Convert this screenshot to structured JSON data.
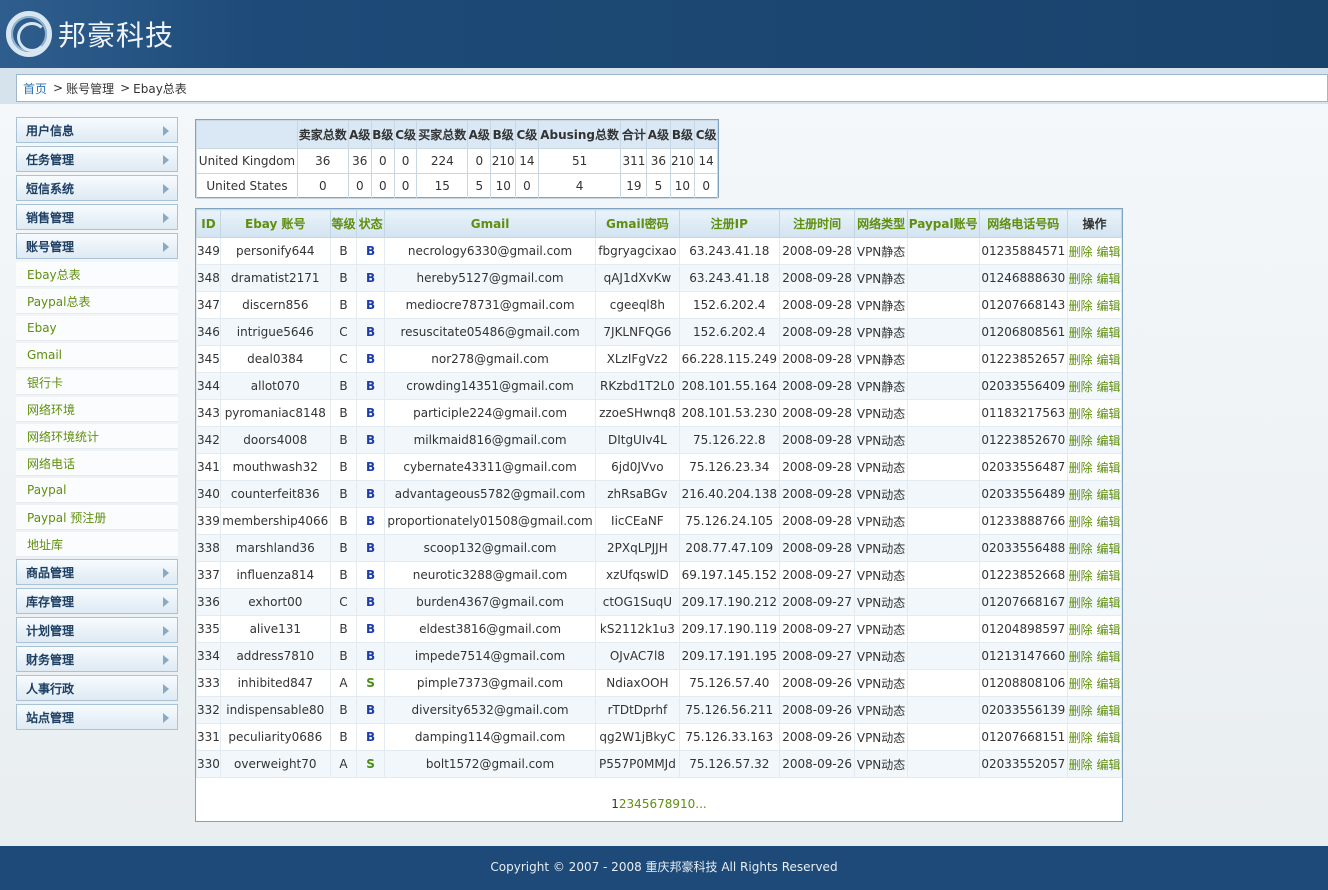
{
  "logo": {
    "text": "邦豪科技"
  },
  "breadcrumb": {
    "home": "首页",
    "level1": "账号管理",
    "level2": "Ebay总表"
  },
  "sidebar": {
    "top": [
      {
        "label": "用户信息"
      },
      {
        "label": "任务管理"
      },
      {
        "label": "短信系统"
      },
      {
        "label": "销售管理"
      },
      {
        "label": "账号管理"
      }
    ],
    "sub": [
      {
        "label": "Ebay总表"
      },
      {
        "label": "Paypal总表"
      },
      {
        "label": "Ebay"
      },
      {
        "label": "Gmail"
      },
      {
        "label": "银行卡"
      },
      {
        "label": "网络环境"
      },
      {
        "label": "网络环境统计"
      },
      {
        "label": "网络电话"
      },
      {
        "label": "Paypal"
      },
      {
        "label": "Paypal 预注册"
      },
      {
        "label": "地址库"
      }
    ],
    "bottom": [
      {
        "label": "商品管理"
      },
      {
        "label": "库存管理"
      },
      {
        "label": "计划管理"
      },
      {
        "label": "财务管理"
      },
      {
        "label": "人事行政"
      },
      {
        "label": "站点管理"
      }
    ]
  },
  "summary": {
    "headers": [
      "",
      "卖家总数",
      "A级",
      "B级",
      "C级",
      "买家总数",
      "A级",
      "B级",
      "C级",
      "Abusing总数",
      "合计",
      "A级",
      "B级",
      "C级"
    ],
    "rows": [
      [
        "United Kingdom",
        "36",
        "36",
        "0",
        "0",
        "224",
        "0",
        "210",
        "14",
        "51",
        "311",
        "36",
        "210",
        "14"
      ],
      [
        "United States",
        "0",
        "0",
        "0",
        "0",
        "15",
        "5",
        "10",
        "0",
        "4",
        "19",
        "5",
        "10",
        "0"
      ]
    ]
  },
  "grid": {
    "headers": [
      "ID",
      "Ebay 账号",
      "等级",
      "状态",
      "Gmail",
      "Gmail密码",
      "注册IP",
      "注册时间",
      "网络类型",
      "Paypal账号",
      "网络电话号码",
      "操作"
    ],
    "delete_label": "删除",
    "edit_label": "编辑",
    "rows": [
      [
        "349",
        "personify644",
        "B",
        "B",
        "necrology6330@gmail.com",
        "fbgryagcixao",
        "63.243.41.18",
        "2008-09-28",
        "VPN静态",
        "",
        "01235884571"
      ],
      [
        "348",
        "dramatist2171",
        "B",
        "B",
        "hereby5127@gmail.com",
        "qAJ1dXvKw",
        "63.243.41.18",
        "2008-09-28",
        "VPN静态",
        "",
        "01246888630"
      ],
      [
        "347",
        "discern856",
        "B",
        "B",
        "mediocre78731@gmail.com",
        "cgeeql8h",
        "152.6.202.4",
        "2008-09-28",
        "VPN静态",
        "",
        "01207668143"
      ],
      [
        "346",
        "intrigue5646",
        "C",
        "B",
        "resuscitate05486@gmail.com",
        "7JKLNFQG6",
        "152.6.202.4",
        "2008-09-28",
        "VPN静态",
        "",
        "01206808561"
      ],
      [
        "345",
        "deal0384",
        "C",
        "B",
        "nor278@gmail.com",
        "XLzIFgVz2",
        "66.228.115.249",
        "2008-09-28",
        "VPN静态",
        "",
        "01223852657"
      ],
      [
        "344",
        "allot070",
        "B",
        "B",
        "crowding14351@gmail.com",
        "RKzbd1T2L0",
        "208.101.55.164",
        "2008-09-28",
        "VPN静态",
        "",
        "02033556409"
      ],
      [
        "343",
        "pyromaniac8148",
        "B",
        "B",
        "participle224@gmail.com",
        "zzoeSHwnq8",
        "208.101.53.230",
        "2008-09-28",
        "VPN动态",
        "",
        "01183217563"
      ],
      [
        "342",
        "doors4008",
        "B",
        "B",
        "milkmaid816@gmail.com",
        "DItgUIv4L",
        "75.126.22.8",
        "2008-09-28",
        "VPN动态",
        "",
        "01223852670"
      ],
      [
        "341",
        "mouthwash32",
        "B",
        "B",
        "cybernate43311@gmail.com",
        "6jd0JVvo",
        "75.126.23.34",
        "2008-09-28",
        "VPN动态",
        "",
        "02033556487"
      ],
      [
        "340",
        "counterfeit836",
        "B",
        "B",
        "advantageous5782@gmail.com",
        "zhRsaBGv",
        "216.40.204.138",
        "2008-09-28",
        "VPN动态",
        "",
        "02033556489"
      ],
      [
        "339",
        "membership4066",
        "B",
        "B",
        "proportionately01508@gmail.com",
        "IicCEaNF",
        "75.126.24.105",
        "2008-09-28",
        "VPN动态",
        "",
        "01233888766"
      ],
      [
        "338",
        "marshland36",
        "B",
        "B",
        "scoop132@gmail.com",
        "2PXqLPJJH",
        "208.77.47.109",
        "2008-09-28",
        "VPN动态",
        "",
        "02033556488"
      ],
      [
        "337",
        "influenza814",
        "B",
        "B",
        "neurotic3288@gmail.com",
        "xzUfqswlD",
        "69.197.145.152",
        "2008-09-27",
        "VPN动态",
        "",
        "01223852668"
      ],
      [
        "336",
        "exhort00",
        "C",
        "B",
        "burden4367@gmail.com",
        "ctOG1SuqU",
        "209.17.190.212",
        "2008-09-27",
        "VPN动态",
        "",
        "01207668167"
      ],
      [
        "335",
        "alive131",
        "B",
        "B",
        "eldest3816@gmail.com",
        "kS2112k1u3",
        "209.17.190.119",
        "2008-09-27",
        "VPN动态",
        "",
        "01204898597"
      ],
      [
        "334",
        "address7810",
        "B",
        "B",
        "impede7514@gmail.com",
        "OJvAC7l8",
        "209.17.191.195",
        "2008-09-27",
        "VPN动态",
        "",
        "01213147660"
      ],
      [
        "333",
        "inhibited847",
        "A",
        "S",
        "pimple7373@gmail.com",
        "NdiaxOOH",
        "75.126.57.40",
        "2008-09-26",
        "VPN动态",
        "",
        "01208808106"
      ],
      [
        "332",
        "indispensable80",
        "B",
        "B",
        "diversity6532@gmail.com",
        "rTDtDprhf",
        "75.126.56.211",
        "2008-09-26",
        "VPN动态",
        "",
        "02033556139"
      ],
      [
        "331",
        "peculiarity0686",
        "B",
        "B",
        "damping114@gmail.com",
        "qg2W1jBkyC",
        "75.126.33.163",
        "2008-09-26",
        "VPN动态",
        "",
        "01207668151"
      ],
      [
        "330",
        "overweight70",
        "A",
        "S",
        "bolt1572@gmail.com",
        "P557P0MMJd",
        "75.126.57.32",
        "2008-09-26",
        "VPN动态",
        "",
        "02033552057"
      ]
    ]
  },
  "pager": {
    "current": "1",
    "pages": [
      "2",
      "3",
      "4",
      "5",
      "6",
      "7",
      "8",
      "9",
      "10",
      "..."
    ]
  },
  "footer": {
    "text": "Copyright © 2007 - 2008 重庆邦豪科技 All Rights Reserved"
  }
}
